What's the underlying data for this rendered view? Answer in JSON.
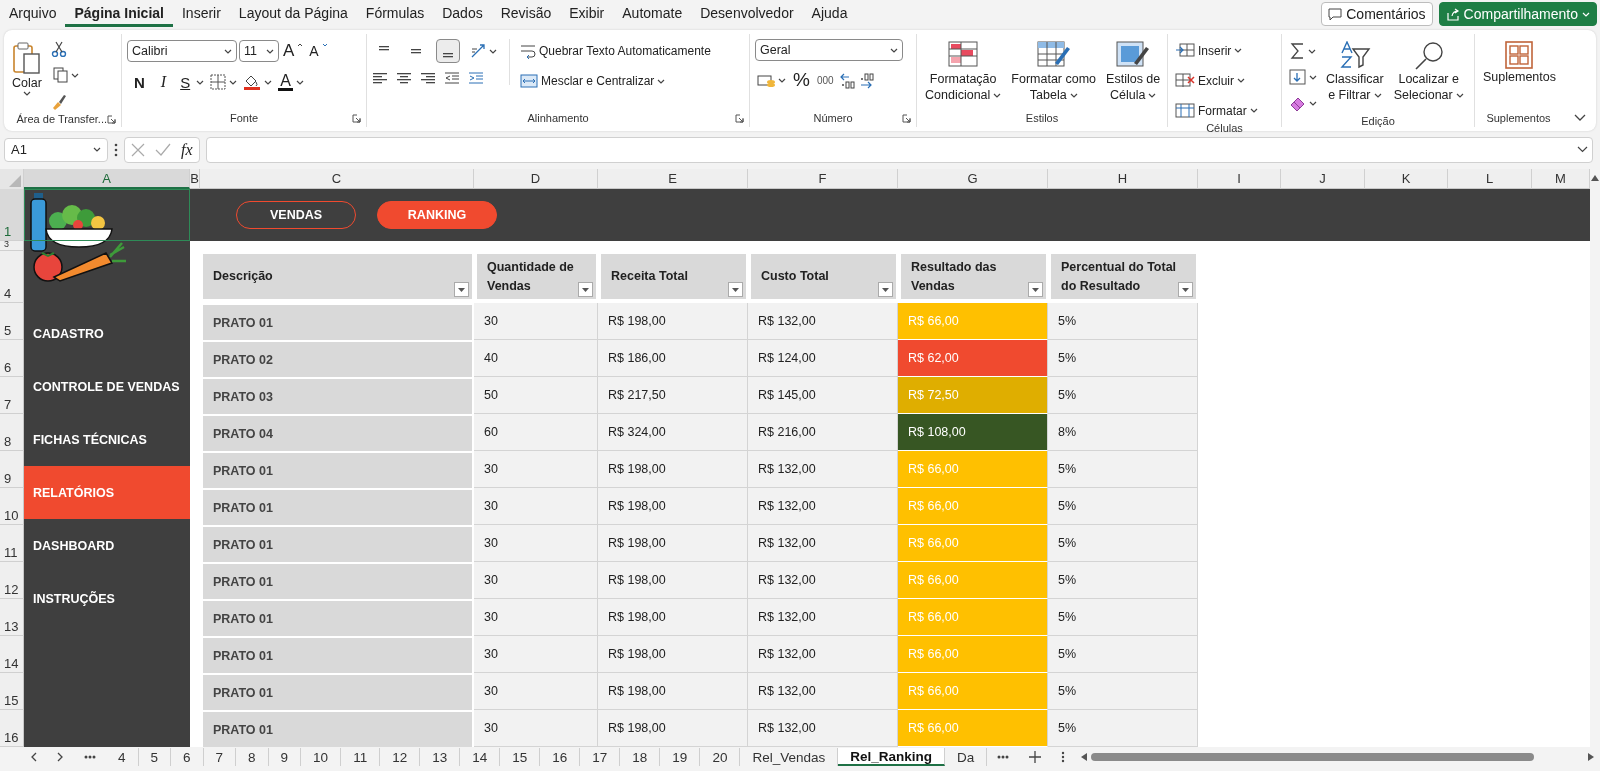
{
  "menu_tabs": [
    {
      "label": "Arquivo",
      "selected": false
    },
    {
      "label": "Página Inicial",
      "selected": true
    },
    {
      "label": "Inserir",
      "selected": false
    },
    {
      "label": "Layout da Página",
      "selected": false
    },
    {
      "label": "Fórmulas",
      "selected": false
    },
    {
      "label": "Dados",
      "selected": false
    },
    {
      "label": "Revisão",
      "selected": false
    },
    {
      "label": "Exibir",
      "selected": false
    },
    {
      "label": "Automate",
      "selected": false
    },
    {
      "label": "Desenvolvedor",
      "selected": false
    },
    {
      "label": "Ajuda",
      "selected": false
    }
  ],
  "header_buttons": [
    {
      "label": "Comentários",
      "kind": "outline"
    },
    {
      "label": "Compartilhamento",
      "kind": "primary"
    }
  ],
  "ribbon": {
    "clipboard": {
      "label": "Área de Transfer...",
      "launcher": true,
      "paste": "Colar"
    },
    "font": {
      "label": "Fonte",
      "launcher": true,
      "font_name": "Calibri",
      "font_size": "11",
      "grow": "A",
      "shrink": "A",
      "bold": "N",
      "italic": "I",
      "underline": "S",
      "font_color": "A"
    },
    "alignment": {
      "label": "Alinhamento",
      "launcher": true,
      "vertical_align": [
        {
          "selected": false
        },
        {
          "selected": false
        },
        {
          "selected": true
        }
      ],
      "wrap": "Quebrar Texto Automaticamente",
      "merge": "Mesclar e Centralizar"
    },
    "number": {
      "label": "Número",
      "launcher": true,
      "format": "Geral",
      "percent": "%",
      "thousands": "000"
    },
    "styles": {
      "label": "Estilos",
      "buttons": [
        {
          "lines": [
            "Formatação",
            "Condicional"
          ]
        },
        {
          "lines": [
            "Formatar como",
            "Tabela"
          ]
        },
        {
          "lines": [
            "Estilos de",
            "Célula"
          ]
        }
      ]
    },
    "cells": {
      "label": "Células",
      "buttons": [
        "Inserir",
        "Excluir",
        "Formatar"
      ]
    },
    "editing": {
      "label": "Edição",
      "buttons": [
        {
          "lines": [
            "Classificar",
            "e Filtrar"
          ]
        },
        {
          "lines": [
            "Localizar e",
            "Selecionar"
          ]
        }
      ]
    },
    "addins": {
      "label": "Suplementos",
      "button": "Suplementos"
    }
  },
  "formula_bar": {
    "name_box": "A1",
    "fx": "fx"
  },
  "columns": [
    {
      "label": "A",
      "selected": true
    },
    {
      "label": "B",
      "selected": false
    },
    {
      "label": "C",
      "selected": false
    },
    {
      "label": "D",
      "selected": false
    },
    {
      "label": "E",
      "selected": false
    },
    {
      "label": "F",
      "selected": false
    },
    {
      "label": "G",
      "selected": false
    },
    {
      "label": "H",
      "selected": false
    },
    {
      "label": "I",
      "selected": false
    },
    {
      "label": "J",
      "selected": false
    },
    {
      "label": "K",
      "selected": false
    },
    {
      "label": "L",
      "selected": false
    },
    {
      "label": "M",
      "selected": false
    }
  ],
  "row_headers": [
    {
      "label": "1",
      "selected": true
    },
    {
      "label": "3",
      "selected": false
    },
    {
      "label": "4",
      "selected": false
    },
    {
      "label": "5",
      "selected": false
    },
    {
      "label": "6",
      "selected": false
    },
    {
      "label": "7",
      "selected": false
    },
    {
      "label": "8",
      "selected": false
    },
    {
      "label": "9",
      "selected": false
    },
    {
      "label": "10",
      "selected": false
    },
    {
      "label": "11",
      "selected": false
    },
    {
      "label": "12",
      "selected": false
    },
    {
      "label": "13",
      "selected": false
    },
    {
      "label": "14",
      "selected": false
    },
    {
      "label": "15",
      "selected": false
    },
    {
      "label": "16",
      "selected": false
    }
  ],
  "top_buttons": [
    {
      "label": "VENDAS",
      "selected": false
    },
    {
      "label": "RANKING",
      "selected": true
    }
  ],
  "nav": [
    {
      "label": "CADASTRO",
      "selected": false
    },
    {
      "label": "CONTROLE DE VENDAS",
      "selected": false
    },
    {
      "label": "FICHAS TÉCNICAS",
      "selected": false
    },
    {
      "label": "RELATÓRIOS",
      "selected": true
    },
    {
      "label": "DASHBOARD",
      "selected": false
    },
    {
      "label": "INSTRUÇÕES",
      "selected": false
    }
  ],
  "table": {
    "columns": [
      "Descrição",
      "Quantidade de Vendas",
      "Receita Total",
      "Custo Total",
      "Resultado das Vendas",
      "Percentual do Total do Resultado"
    ],
    "rows": [
      {
        "cells": [
          "PRATO 01",
          "30",
          "R$ 198,00",
          "R$ 132,00",
          "R$ 66,00",
          "5%"
        ],
        "color": "#ffc000"
      },
      {
        "cells": [
          "PRATO 02",
          "40",
          "R$ 186,00",
          "R$ 124,00",
          "R$ 62,00",
          "5%"
        ],
        "color": "#f04a2f"
      },
      {
        "cells": [
          "PRATO 03",
          "50",
          "R$ 217,50",
          "R$ 145,00",
          "R$ 72,50",
          "5%"
        ],
        "color": "#dfae00"
      },
      {
        "cells": [
          "PRATO 04",
          "60",
          "R$ 324,00",
          "R$ 216,00",
          "R$ 108,00",
          "8%"
        ],
        "color": "#375623"
      },
      {
        "cells": [
          "PRATO 01",
          "30",
          "R$ 198,00",
          "R$ 132,00",
          "R$ 66,00",
          "5%"
        ],
        "color": "#ffc000"
      },
      {
        "cells": [
          "PRATO 01",
          "30",
          "R$ 198,00",
          "R$ 132,00",
          "R$ 66,00",
          "5%"
        ],
        "color": "#ffc000"
      },
      {
        "cells": [
          "PRATO 01",
          "30",
          "R$ 198,00",
          "R$ 132,00",
          "R$ 66,00",
          "5%"
        ],
        "color": "#ffc000"
      },
      {
        "cells": [
          "PRATO 01",
          "30",
          "R$ 198,00",
          "R$ 132,00",
          "R$ 66,00",
          "5%"
        ],
        "color": "#ffc000"
      },
      {
        "cells": [
          "PRATO 01",
          "30",
          "R$ 198,00",
          "R$ 132,00",
          "R$ 66,00",
          "5%"
        ],
        "color": "#ffc000"
      },
      {
        "cells": [
          "PRATO 01",
          "30",
          "R$ 198,00",
          "R$ 132,00",
          "R$ 66,00",
          "5%"
        ],
        "color": "#ffc000"
      },
      {
        "cells": [
          "PRATO 01",
          "30",
          "R$ 198,00",
          "R$ 132,00",
          "R$ 66,00",
          "5%"
        ],
        "color": "#ffc000"
      },
      {
        "cells": [
          "PRATO 01",
          "30",
          "R$ 198,00",
          "R$ 132,00",
          "R$ 66,00",
          "5%"
        ],
        "color": "#ffc000"
      }
    ]
  },
  "sheet_tabs": [
    {
      "label": "4",
      "selected": false
    },
    {
      "label": "5",
      "selected": false
    },
    {
      "label": "6",
      "selected": false
    },
    {
      "label": "7",
      "selected": false
    },
    {
      "label": "8",
      "selected": false
    },
    {
      "label": "9",
      "selected": false
    },
    {
      "label": "10",
      "selected": false
    },
    {
      "label": "11",
      "selected": false
    },
    {
      "label": "12",
      "selected": false
    },
    {
      "label": "13",
      "selected": false
    },
    {
      "label": "14",
      "selected": false
    },
    {
      "label": "15",
      "selected": false
    },
    {
      "label": "16",
      "selected": false
    },
    {
      "label": "17",
      "selected": false
    },
    {
      "label": "18",
      "selected": false
    },
    {
      "label": "19",
      "selected": false
    },
    {
      "label": "20",
      "selected": false
    },
    {
      "label": "Rel_Vendas",
      "selected": false
    },
    {
      "label": "Rel_Ranking",
      "selected": true
    },
    {
      "label": "Da",
      "selected": false
    }
  ]
}
